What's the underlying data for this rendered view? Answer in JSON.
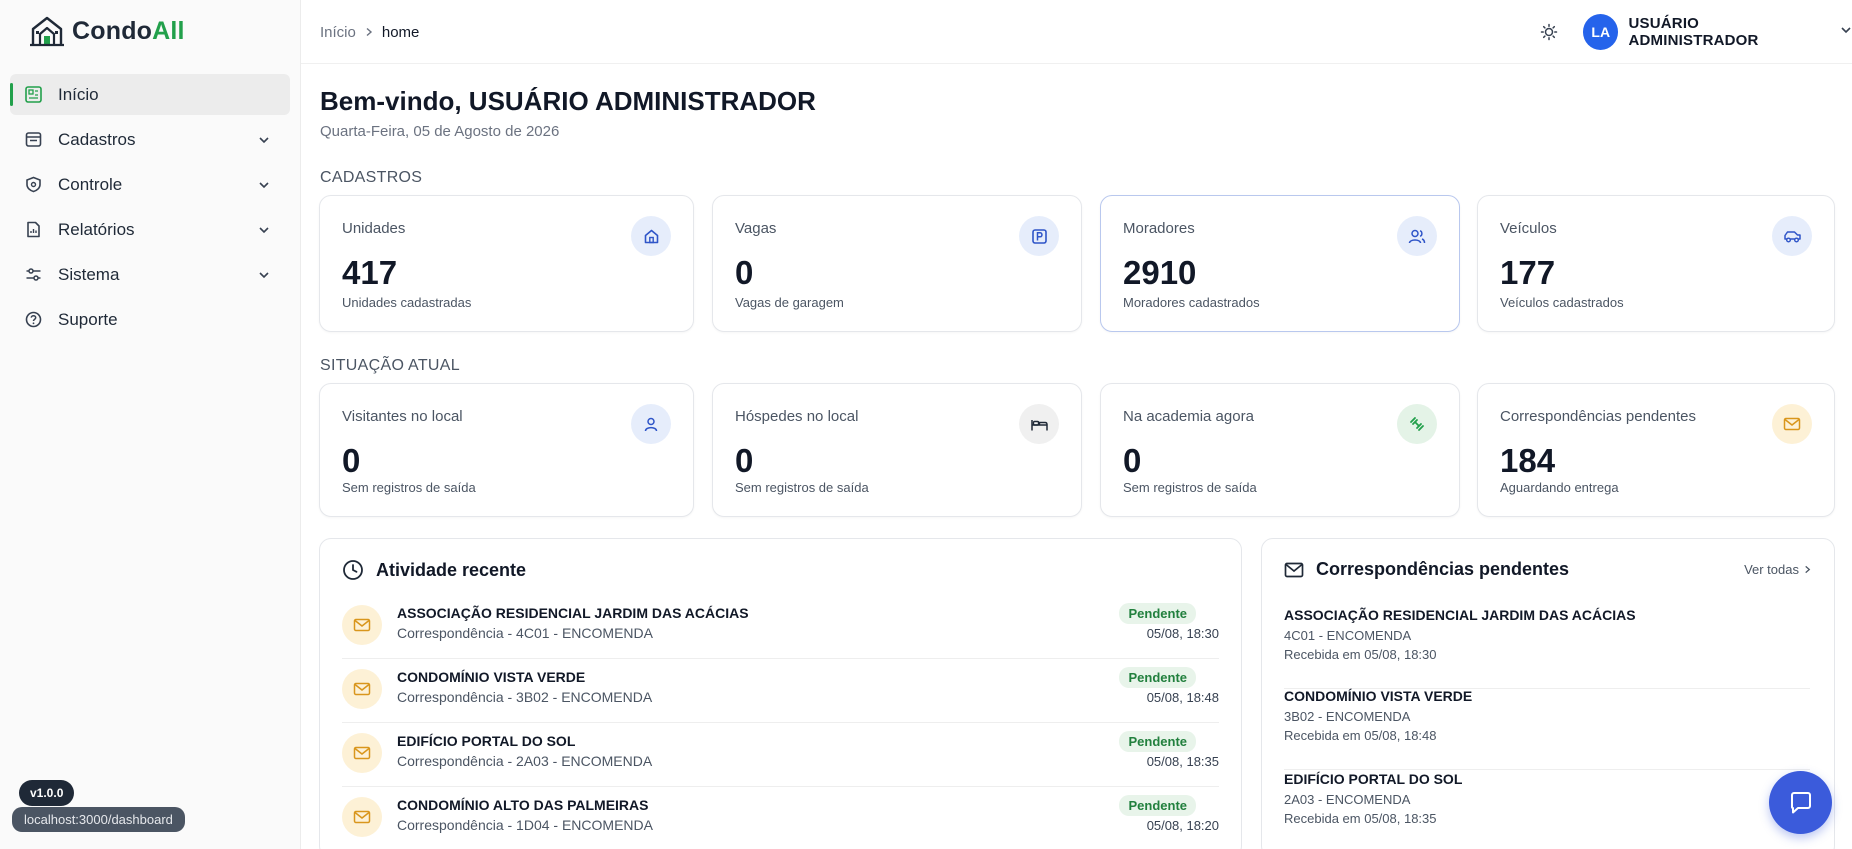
{
  "app": {
    "name_prefix": "Condo",
    "name_suffix": "All"
  },
  "sidebar": {
    "items": [
      {
        "label": "Início"
      },
      {
        "label": "Cadastros"
      },
      {
        "label": "Controle"
      },
      {
        "label": "Relatórios"
      },
      {
        "label": "Sistema"
      },
      {
        "label": "Suporte"
      }
    ],
    "version": "v1.0.0",
    "status_url": "localhost:3000/dashboard"
  },
  "header": {
    "breadcrumb": {
      "root": "Início",
      "current": "home"
    },
    "avatar_initials": "LA",
    "user_name": "USUÁRIO ADMINISTRADOR"
  },
  "main": {
    "welcome": "Bem-vindo, USUÁRIO ADMINISTRADOR",
    "date": "Quarta-Feira, 05 de Agosto de 2026",
    "cadastros_label": "CADASTROS",
    "situacao_label": "SITUAÇÃO ATUAL",
    "cadastros": [
      {
        "title": "Unidades",
        "value": "417",
        "sub": "Unidades cadastradas"
      },
      {
        "title": "Vagas",
        "value": "0",
        "sub": "Vagas de garagem"
      },
      {
        "title": "Moradores",
        "value": "2910",
        "sub": "Moradores cadastrados"
      },
      {
        "title": "Veículos",
        "value": "177",
        "sub": "Veículos cadastrados"
      }
    ],
    "situacao": [
      {
        "title": "Visitantes no local",
        "value": "0",
        "sub": "Sem registros de saída"
      },
      {
        "title": "Hóspedes no local",
        "value": "0",
        "sub": "Sem registros de saída"
      },
      {
        "title": "Na academia agora",
        "value": "0",
        "sub": "Sem registros de saída"
      },
      {
        "title": "Correspondências pendentes",
        "value": "184",
        "sub": "Aguardando entrega"
      }
    ]
  },
  "activity": {
    "title": "Atividade recente",
    "rows": [
      {
        "title": "ASSOCIAÇÃO RESIDENCIAL JARDIM DAS ACÁCIAS",
        "sub": "Correspondência - 4C01 - ENCOMENDA",
        "badge": "Pendente",
        "time": "05/08, 18:30"
      },
      {
        "title": "CONDOMÍNIO VISTA VERDE",
        "sub": "Correspondência - 3B02 - ENCOMENDA",
        "badge": "Pendente",
        "time": "05/08, 18:48"
      },
      {
        "title": "EDIFÍCIO PORTAL DO SOL",
        "sub": "Correspondência - 2A03 - ENCOMENDA",
        "badge": "Pendente",
        "time": "05/08, 18:35"
      },
      {
        "title": "CONDOMÍNIO ALTO DAS PALMEIRAS",
        "sub": "Correspondência - 1D04 - ENCOMENDA",
        "badge": "Pendente",
        "time": "05/08, 18:20"
      }
    ]
  },
  "correspondence": {
    "title": "Correspondências pendentes",
    "see_all": "Ver todas",
    "rows": [
      {
        "title": "ASSOCIAÇÃO RESIDENCIAL JARDIM DAS ACÁCIAS",
        "sub": "4C01 - ENCOMENDA",
        "received": "Recebida em 05/08, 18:30"
      },
      {
        "title": "CONDOMÍNIO VISTA VERDE",
        "sub": "3B02 - ENCOMENDA",
        "received": "Recebida em 05/08, 18:48"
      },
      {
        "title": "EDIFÍCIO PORTAL DO SOL",
        "sub": "2A03 - ENCOMENDA",
        "received": "Recebida em 05/08, 18:35"
      }
    ]
  },
  "colors": {
    "accent_green": "#22a04b",
    "primary_blue": "#2563eb",
    "chat_blue": "#3b5bdb",
    "badge_green_bg": "#e8f4ea",
    "mail_bg": "#fdf1d6"
  }
}
